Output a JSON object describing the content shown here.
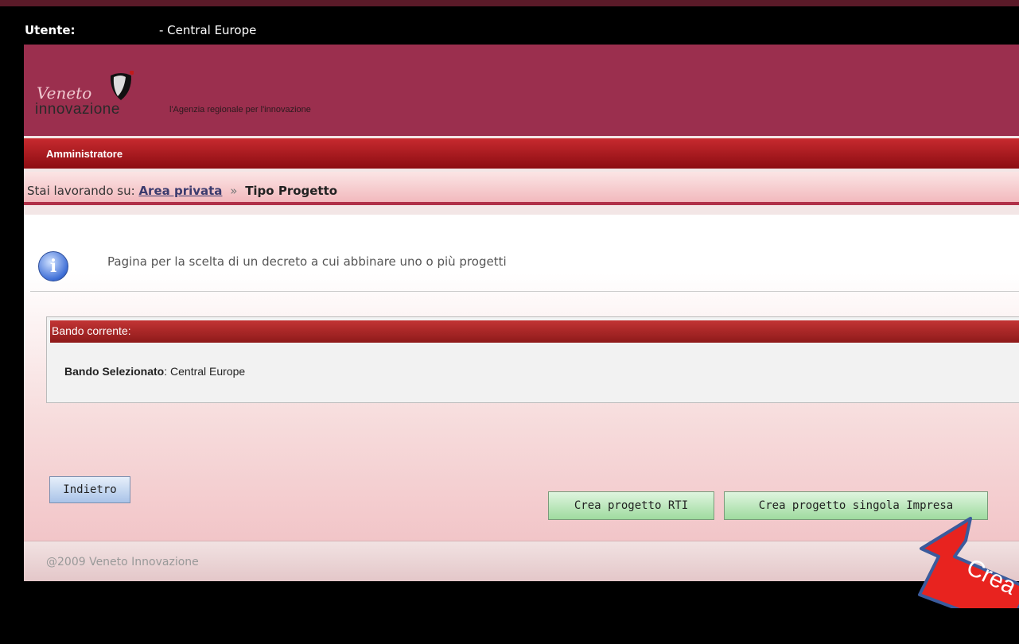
{
  "user_bar": {
    "label": "Utente:",
    "value": "- Central Europe"
  },
  "header": {
    "logo_script": "Veneto",
    "logo_word": "innovazione",
    "tagline": "l'Agenzia regionale per l'innovazione"
  },
  "role_bar": {
    "label": "Amministratore"
  },
  "breadcrumb": {
    "prefix": "Stai lavorando su:",
    "link": "Area privata",
    "separator": "»",
    "current": "Tipo Progetto"
  },
  "info": {
    "text": "Pagina per la scelta di un decreto a cui abbinare uno o più progetti",
    "icon": "info-icon"
  },
  "panel": {
    "title": "Bando corrente:",
    "field_label": "Bando Selezionato",
    "field_value": ": Central Europe"
  },
  "buttons": {
    "back": "Indietro",
    "create_rti": "Crea progetto RTI",
    "create_single": "Crea progetto singola Impresa"
  },
  "footer": {
    "copyright": "@2009 Veneto Innovazione"
  },
  "annotation": {
    "arrow_text": "Crea",
    "arrow_color": "#e8231f",
    "arrow_outline": "#3b5b9c"
  }
}
